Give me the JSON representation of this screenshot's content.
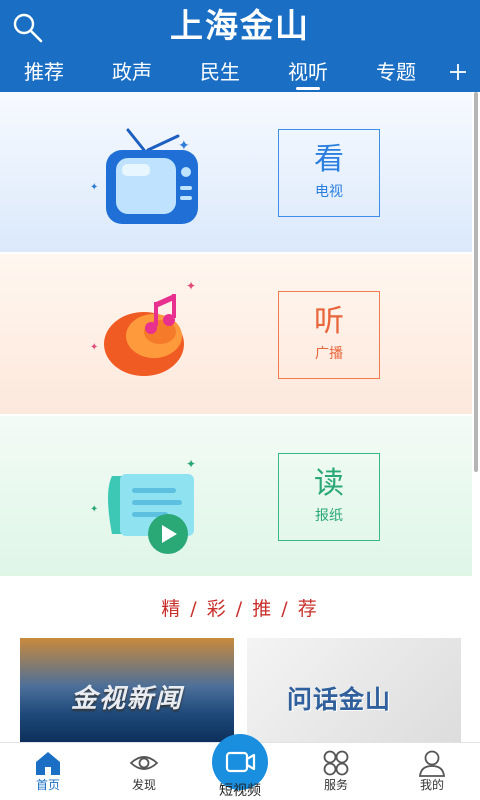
{
  "header": {
    "title": "上海金山",
    "search_icon": "search-icon",
    "add_icon": "plus-icon",
    "tabs": [
      {
        "label": "推荐",
        "active": false
      },
      {
        "label": "政声",
        "active": false
      },
      {
        "label": "民生",
        "active": false
      },
      {
        "label": "视听",
        "active": true
      },
      {
        "label": "专题",
        "active": false
      }
    ]
  },
  "media": [
    {
      "big": "看",
      "small": "电视",
      "icon": "tv-icon",
      "color": "#2a7ee0"
    },
    {
      "big": "听",
      "small": "广播",
      "icon": "radio-speaker-icon",
      "color": "#e9653c"
    },
    {
      "big": "读",
      "small": "报纸",
      "icon": "newspaper-play-icon",
      "color": "#2aa876"
    }
  ],
  "recommend": {
    "title": "精 / 彩 / 推 / 荐",
    "items": [
      {
        "text": "金视新闻"
      },
      {
        "text": "问话金山"
      }
    ]
  },
  "bottom_nav": {
    "items": [
      {
        "label": "首页",
        "icon": "home-icon",
        "active": true
      },
      {
        "label": "发现",
        "icon": "eye-icon",
        "active": false
      },
      {
        "label": "服务",
        "icon": "grid-icon",
        "active": false
      },
      {
        "label": "我的",
        "icon": "user-icon",
        "active": false
      }
    ],
    "center_label": "短视频",
    "center_icon": "video-camera-icon"
  },
  "colors": {
    "brand": "#1a6fc4",
    "accent_red": "#c9302c"
  }
}
